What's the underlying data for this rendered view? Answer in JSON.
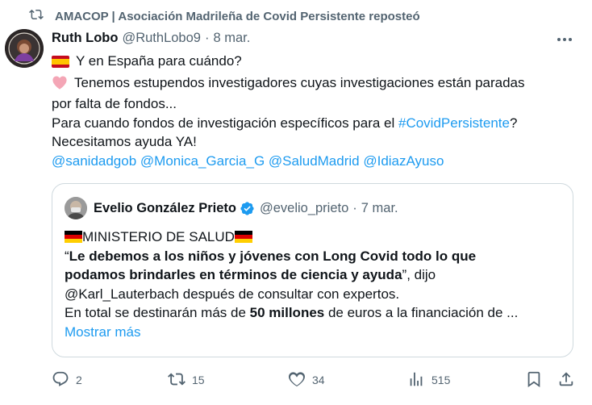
{
  "repost": {
    "text": "AMACOP | Asociación Madrileña de Covid Persistente reposteó"
  },
  "tweet": {
    "author_name": "Ruth Lobo",
    "author_handle": "@RuthLobo9",
    "separator": "·",
    "date": "8 mar.",
    "lines": {
      "l1": "Y en España para cuándo?",
      "l2": "Tenemos estupendos investigadores cuyas investigaciones están paradas",
      "l3": "por falta de fondos...",
      "l4_pre": "Para cuando fondos de investigación específicos para el ",
      "l4_hashtag": "#CovidPersistente",
      "l4_post": "?",
      "l5": "Necesitamos ayuda YA!"
    },
    "mentions": [
      "@sanidadgob",
      "@Monica_Garcia_G",
      "@SaludMadrid",
      "@IdiazAyuso"
    ],
    "emoji_1": "spain-flag",
    "emoji_2": "pink-heart"
  },
  "quote": {
    "author_name": "Evelio González Prieto",
    "author_handle": "@evelio_prieto",
    "separator": "·",
    "date": "7 mar.",
    "title": "MINISTERIO DE SALUD",
    "q_open": "“",
    "bold_1": "Le debemos a los niños y jóvenes con Long Covid todo lo que",
    "bold_2": "podamos brindarles en términos de ciencia y ayuda",
    "after_bold": "”, dijo",
    "line4": "@Karl_Lauterbach  después de consultar con expertos.",
    "line5_pre": "En total se destinarán más de ",
    "line5_bold": "50 millones",
    "line5_post": " de euros a la financiación de ...",
    "show_more": "Mostrar más",
    "flag": "germany-flag"
  },
  "actions": {
    "replies": "2",
    "reposts": "15",
    "likes": "34",
    "views": "515"
  },
  "colors": {
    "link": "#1d9bf0",
    "muted": "#536471",
    "text": "#0f1419",
    "border": "#cfd9de"
  }
}
